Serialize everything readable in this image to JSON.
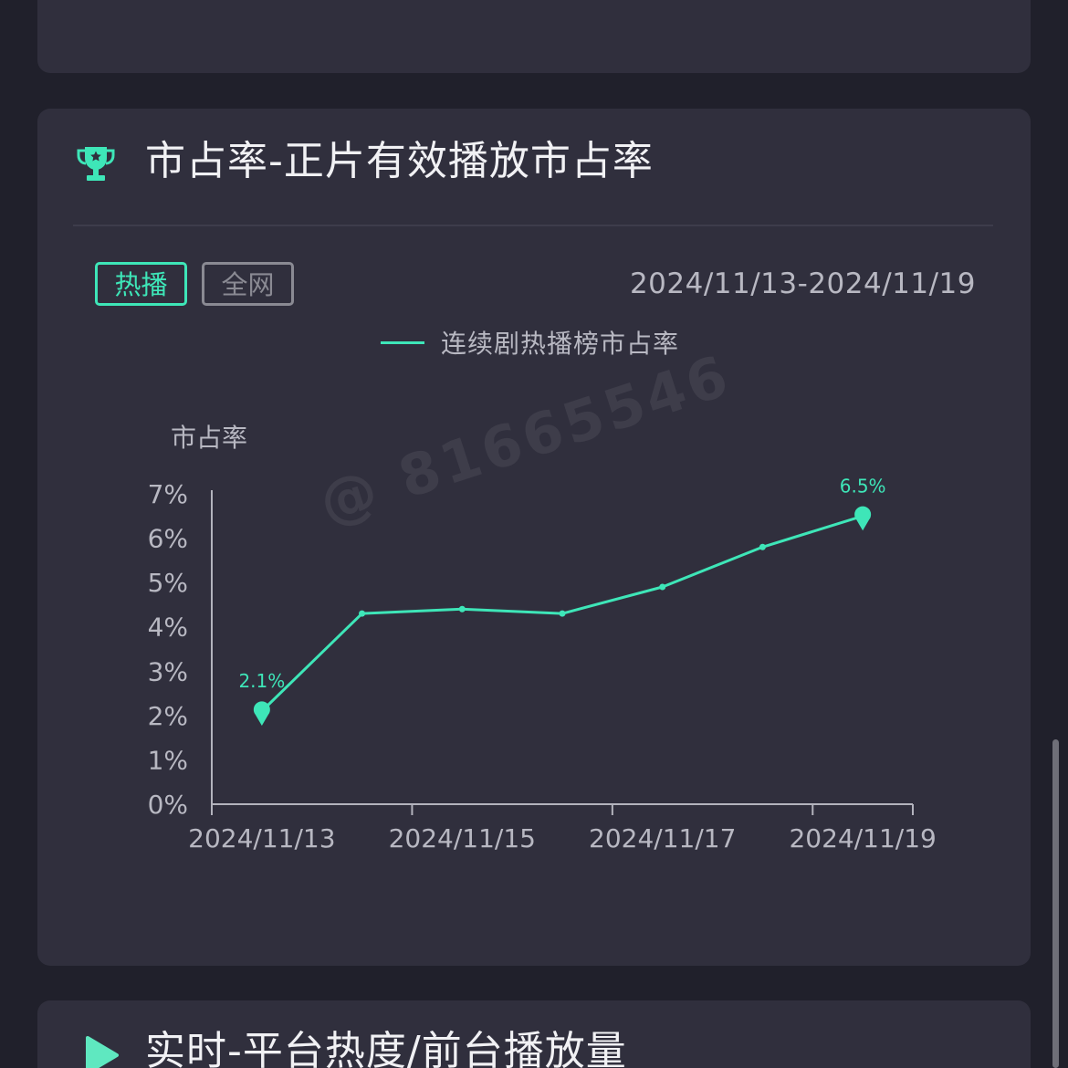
{
  "card_main": {
    "title": "市占率-正片有效播放市占率",
    "tabs": [
      {
        "label": "热播",
        "active": true
      },
      {
        "label": "全网",
        "active": false
      }
    ],
    "date_range": "2024/11/13-2024/11/19",
    "icon": "trophy-icon"
  },
  "card_next": {
    "title": "实时-平台热度/前台播放量",
    "icon": "play-icon"
  },
  "watermark": "@ 81665546",
  "colors": {
    "accent": "#3ee6b8",
    "card_bg": "#302f3d",
    "page_bg": "#20202b",
    "text": "#f1f1f4",
    "muted": "#b8b8c2"
  },
  "chart_data": {
    "type": "line",
    "ylabel": "市占率",
    "xlabel": "",
    "x": [
      "2024/11/13",
      "2024/11/14",
      "2024/11/15",
      "2024/11/16",
      "2024/11/17",
      "2024/11/18",
      "2024/11/19"
    ],
    "x_tick_labels": [
      "2024/11/13",
      "2024/11/15",
      "2024/11/17",
      "2024/11/19"
    ],
    "y_tick_labels": [
      "0%",
      "1%",
      "2%",
      "3%",
      "4%",
      "5%",
      "6%",
      "7%"
    ],
    "ylim": [
      0,
      7
    ],
    "series": [
      {
        "name": "连续剧热播榜市占率",
        "values": [
          2.1,
          4.3,
          4.4,
          4.3,
          4.9,
          5.8,
          6.5
        ]
      }
    ],
    "annotations": [
      {
        "x": "2024/11/13",
        "label": "2.1%"
      },
      {
        "x": "2024/11/19",
        "label": "6.5%"
      }
    ],
    "legend_position": "top-center",
    "grid": false
  }
}
